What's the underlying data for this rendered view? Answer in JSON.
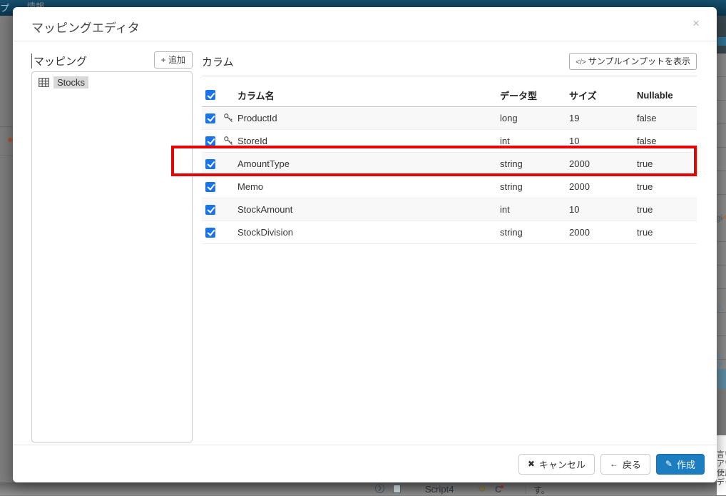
{
  "background": {
    "topbar": {
      "fragment_tab": "プ",
      "fragment_info": "情報"
    },
    "right_edge": {
      "fragment_gi": "gi",
      "fragment_chevron": "〉",
      "fragment_amp": "&ア",
      "fragment_line1": "言い",
      "fragment_line2": "アワ",
      "fragment_line3": "使用",
      "fragment_line4": "デー"
    },
    "bottom_bar": {
      "script_label": "Script4",
      "gear_glyph": "⚙",
      "letter_c": "C",
      "fragment_su": "す。"
    }
  },
  "modal": {
    "title": "マッピングエディタ",
    "close_glyph": "×",
    "mapping_panel": {
      "label": "マッピング",
      "add_button_label": "+ 追加",
      "tree_items": [
        {
          "label": "Stocks",
          "icon": "table-grid-icon"
        }
      ]
    },
    "columns_panel": {
      "label": "カラム",
      "sample_button": {
        "code_icon": "</>",
        "label": "サンプルインプットを表示"
      },
      "table": {
        "headers": {
          "name": "カラム名",
          "type": "データ型",
          "size": "サイズ",
          "nullable": "Nullable"
        },
        "rows": [
          {
            "name": "ProductId",
            "type": "long",
            "size": "19",
            "nullable": "false",
            "key": true,
            "checked": true,
            "highlight": false
          },
          {
            "name": "StoreId",
            "type": "int",
            "size": "10",
            "nullable": "false",
            "key": true,
            "checked": true,
            "highlight": false
          },
          {
            "name": "AmountType",
            "type": "string",
            "size": "2000",
            "nullable": "true",
            "key": false,
            "checked": true,
            "highlight": true
          },
          {
            "name": "Memo",
            "type": "string",
            "size": "2000",
            "nullable": "true",
            "key": false,
            "checked": true,
            "highlight": false
          },
          {
            "name": "StockAmount",
            "type": "int",
            "size": "10",
            "nullable": "true",
            "key": false,
            "checked": true,
            "highlight": false
          },
          {
            "name": "StockDivision",
            "type": "string",
            "size": "2000",
            "nullable": "true",
            "key": false,
            "checked": true,
            "highlight": false
          }
        ]
      }
    },
    "footer": {
      "cancel_icon": "✖",
      "cancel_label": "キャンセル",
      "back_icon": "←",
      "back_label": "戻る",
      "create_icon": "✎",
      "create_label": "作成"
    }
  },
  "colors": {
    "checkbox_blue": "#1a73e8",
    "primary_button_blue": "#1d7dc1",
    "highlight_red": "#e30404",
    "topbar_navy": "#0c3650"
  }
}
